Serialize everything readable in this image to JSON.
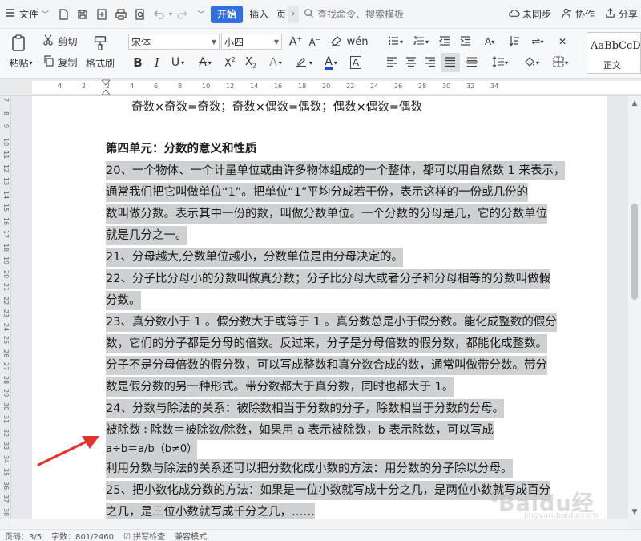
{
  "menu": {
    "file": "文件",
    "tabs": [
      "开始",
      "插入"
    ],
    "tab_more": "页",
    "search_placeholder": "查找命令、搜索模板",
    "sync": "未同步",
    "collab": "协作",
    "share": "分享"
  },
  "ribbon": {
    "paste": "粘贴",
    "cut": "剪切",
    "copy": "复制",
    "format_painter": "格式刷",
    "font_name": "宋体",
    "font_size": "小四",
    "style_sample": "AaBbCcDd",
    "style_name": "正文"
  },
  "ruler": {
    "numbers": [
      "4",
      "2",
      "2",
      "4",
      "6",
      "8",
      "10",
      "12",
      "14",
      "16",
      "18",
      "20",
      "22",
      "24",
      "26",
      "28",
      "30",
      "32",
      "34"
    ]
  },
  "vruler": {
    "numbers": [
      "7",
      "8",
      "9",
      "10",
      "11",
      "12",
      "13",
      "14",
      "15",
      "16",
      "17",
      "18",
      "19",
      "20",
      "21",
      "22",
      "23",
      "24",
      "25",
      "26",
      "27",
      "28",
      "29",
      "30",
      "31",
      "32",
      "33",
      "34",
      "35",
      "36",
      "37",
      "38"
    ]
  },
  "document": {
    "lines": [
      {
        "text": "奇数×奇数=奇数；奇数×偶数=偶数；偶数×偶数=偶数",
        "hl": false,
        "indent": true
      },
      {
        "text": "",
        "hl": false
      },
      {
        "text": "第四单元：分数的意义和性质",
        "hl": false,
        "heading": true
      },
      {
        "text": "20、一个物体、一个计量单位或由许多物体组成的一个整体，都可以用自然数 1 来表示，",
        "hl": true
      },
      {
        "text": "通常我们把它叫做单位“1”。把单位“1”平均分成若干份，表示这样的一份或几份的",
        "hl": true
      },
      {
        "text": "数叫做分数。表示其中一份的数，叫做分数单位。一个分数的分母是几，它的分数单位",
        "hl": true
      },
      {
        "text": "就是几分之一。",
        "hl": true
      },
      {
        "text": "21、分母越大,分数单位越小，分数单位是由分母决定的。",
        "hl": true
      },
      {
        "text": "22、分子比分母小的分数叫做真分数；分子比分母大或者分子和分母相等的分数叫做假",
        "hl": true
      },
      {
        "text": "分数。",
        "hl": true
      },
      {
        "text": "23、真分数小于 1 。假分数大于或等于 1 。真分数总是小于假分数。能化成整数的假分",
        "hl": true
      },
      {
        "text": "数，它们的分子都是分母的倍数。反过来，分子是分母倍数的假分数，都能化成整数。",
        "hl": true
      },
      {
        "text": "分子不是分母倍数的假分数，可以写成整数和真分数合成的数，通常叫做带分数。带分",
        "hl": true
      },
      {
        "text": "数是假分数的另一种形式。带分数都大于真分数，同时也都大于 1。",
        "hl": true
      },
      {
        "text": "24、分数与除法的关系：被除数相当于分数的分子，除数相当于分数的分母。",
        "hl": true
      },
      {
        "text": "被除数÷除数＝被除数/除数，如果用 a 表示被除数，b 表示除数，可以写成",
        "hl": true
      },
      {
        "text": "a÷b＝a/b（b≠0）",
        "hl": true,
        "small": true
      },
      {
        "text": "利用分数与除法的关系还可以把分数化成小数的方法：用分数的分子除以分母。",
        "hl": true
      },
      {
        "text": "25、把小数化成分数的方法：如果是一位小数就写成十分之几，是两位小数就写成百分",
        "hl": true
      },
      {
        "text": "之几，是三位小数就写成千分之几，……",
        "hl": true
      }
    ]
  },
  "status": {
    "page": "页码：3/5",
    "words": "字数：801/2460",
    "spell": "拼写检查",
    "mode": "兼容模式"
  },
  "watermark": {
    "text": "Baidu经验",
    "sub": "jingyan.baidu.com"
  },
  "colors": {
    "accent": "#2f6fe4",
    "highlight": "#cfd0d2",
    "arrow": "#e8302b"
  }
}
